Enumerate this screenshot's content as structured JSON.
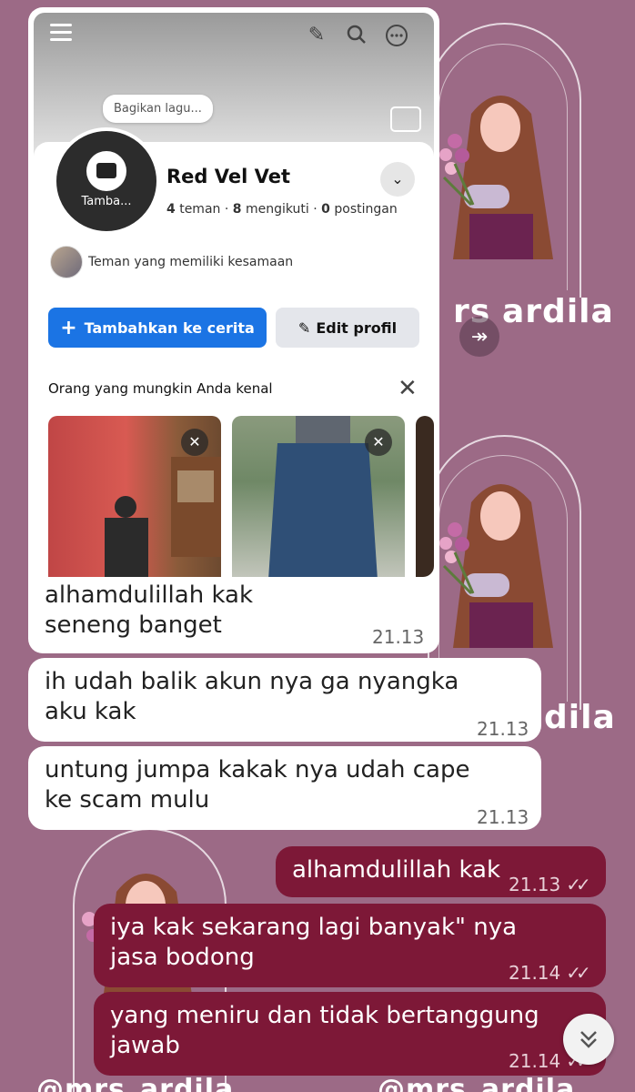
{
  "watermark": {
    "text_1": "rs",
    "text_2": "ardila",
    "text_3": "dila",
    "bottom_text": "@mrs_ardila"
  },
  "screenshot": {
    "share_prompt": "Bagikan lagu...",
    "avatar_label": "Tamba...",
    "profile_name": "Red Vel Vet",
    "stats": {
      "friends": "4",
      "friends_label": "teman",
      "followers": "8",
      "followers_label": "mengikuti",
      "posts": "0",
      "posts_label": "postingan"
    },
    "mutual_text": "Teman yang memiliki kesamaan",
    "add_story_button": "Tambahkan ke cerita",
    "edit_profile_button": "Edit profil",
    "pymk_title": "Orang yang mungkin Anda kenal",
    "message_text": "alhamdulillah kak seneng banget",
    "message_time": "21.13"
  },
  "messages": [
    {
      "text": "ih udah balik akun nya ga nyangka aku kak",
      "time": "21.13",
      "direction": "in"
    },
    {
      "text": "untung jumpa kakak nya udah cape ke scam mulu",
      "time": "21.13",
      "direction": "in"
    },
    {
      "text": "alhamdulillah kak",
      "time": "21.13",
      "direction": "out",
      "read": true
    },
    {
      "text": "iya kak sekarang lagi banyak\" nya jasa bodong",
      "time": "21.14",
      "direction": "out",
      "read": true
    },
    {
      "text": "yang  meniru dan tidak bertanggung jawab",
      "time": "21.14",
      "direction": "out",
      "read": true
    }
  ],
  "icons": {
    "menu": "menu-icon",
    "edit": "pencil-icon",
    "search": "search-icon",
    "more": "more-icon",
    "scroll_down": "double-chevron-down-icon"
  },
  "colors": {
    "background": "#9c6a86",
    "incoming_bubble": "#ffffff",
    "outgoing_bubble": "#7d1837",
    "fb_blue": "#1b74e4"
  }
}
